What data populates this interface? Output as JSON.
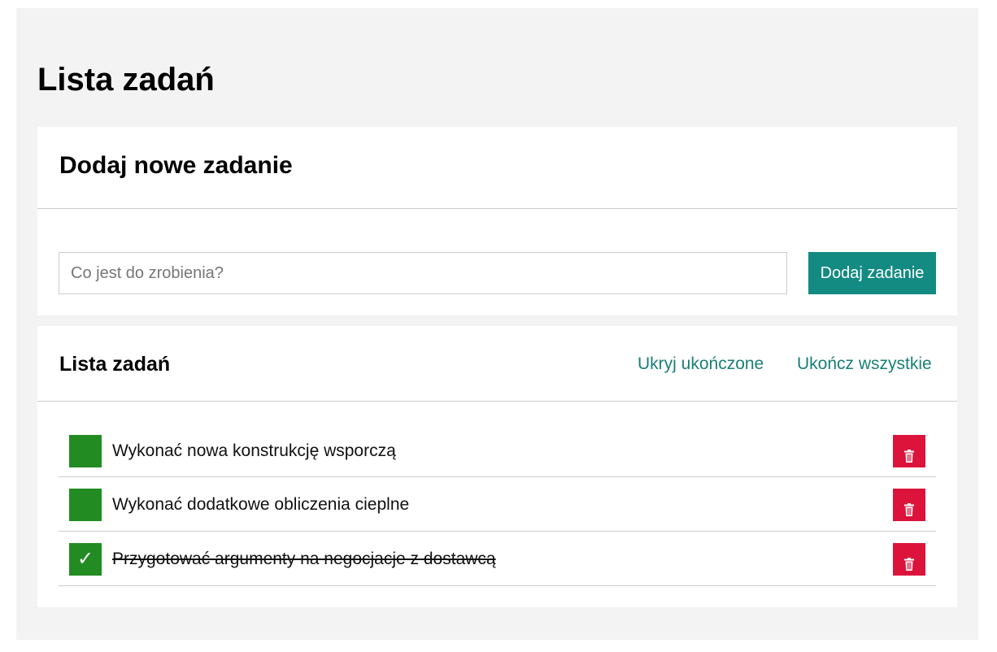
{
  "page": {
    "title": "Lista zadań"
  },
  "add_card": {
    "heading": "Dodaj nowe zadanie",
    "input_placeholder": "Co jest do zrobienia?",
    "input_value": "",
    "button_label": "Dodaj zadanie"
  },
  "list_card": {
    "heading": "Lista zadań",
    "hide_completed_label": "Ukryj ukończone",
    "complete_all_label": "Ukończ wszystkie",
    "tasks": [
      {
        "text": "Wykonać nowa konstrukcję wsporczą",
        "done": false,
        "check_glyph": ""
      },
      {
        "text": "Wykonać dodatkowe obliczenia cieplne",
        "done": false,
        "check_glyph": ""
      },
      {
        "text": "Przygotować argumenty na negocjacje z dostawcą",
        "done": true,
        "check_glyph": "✓"
      }
    ]
  },
  "colors": {
    "accent": "#138b82",
    "link": "#1a7f78",
    "checkbox": "#228b22",
    "delete": "#dc143c",
    "background": "#f3f3f3"
  },
  "icons": {
    "delete": "trash-icon",
    "check": "checkmark-icon"
  }
}
